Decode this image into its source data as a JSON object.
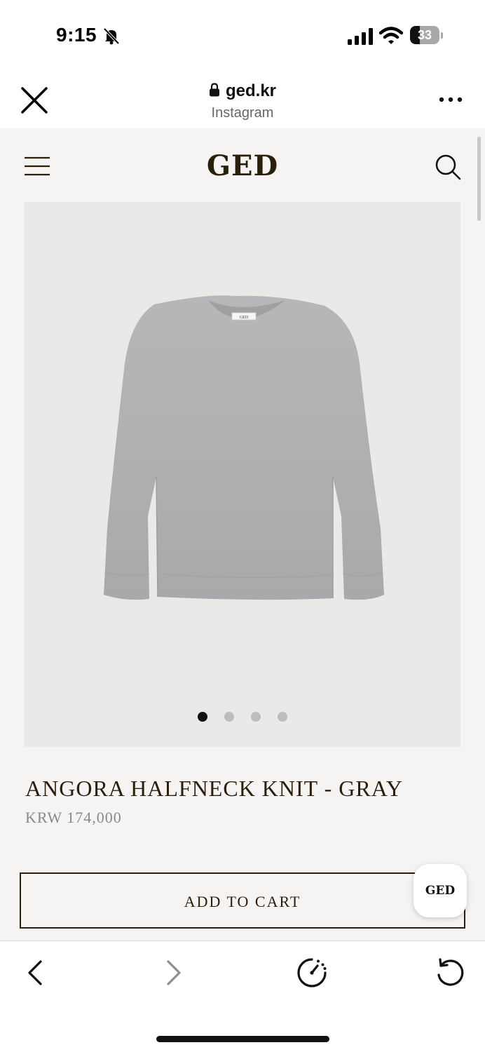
{
  "status_bar": {
    "time": "9:15",
    "battery_level": "33",
    "battery_percent": 33
  },
  "browser": {
    "domain": "ged.kr",
    "source": "Instagram"
  },
  "site": {
    "logo": "GED",
    "chat_bubble_label": "GED"
  },
  "product": {
    "title": "ANGORA HALFNECK KNIT - GRAY",
    "price": "KRW 174,000",
    "image_tag_text": "GED",
    "carousel": {
      "count": 4,
      "active_index": 0
    },
    "add_to_cart_label": "ADD TO CART"
  },
  "icons": {
    "status": [
      "bell-slash-icon",
      "cellular-signal-icon",
      "wifi-icon",
      "battery-icon"
    ],
    "header": [
      "close-icon",
      "lock-icon",
      "more-dots-icon"
    ],
    "site": [
      "hamburger-menu-icon",
      "search-icon"
    ],
    "toolbar": [
      "chevron-left-icon",
      "chevron-right-icon",
      "speedometer-icon",
      "reload-icon"
    ]
  },
  "colors": {
    "page_background": "#f5f4f2",
    "brand_text": "#2b1f0b",
    "price_text": "#8a8a8a",
    "image_background": "#e9e9e8",
    "sweater": "#b1b2b4"
  }
}
